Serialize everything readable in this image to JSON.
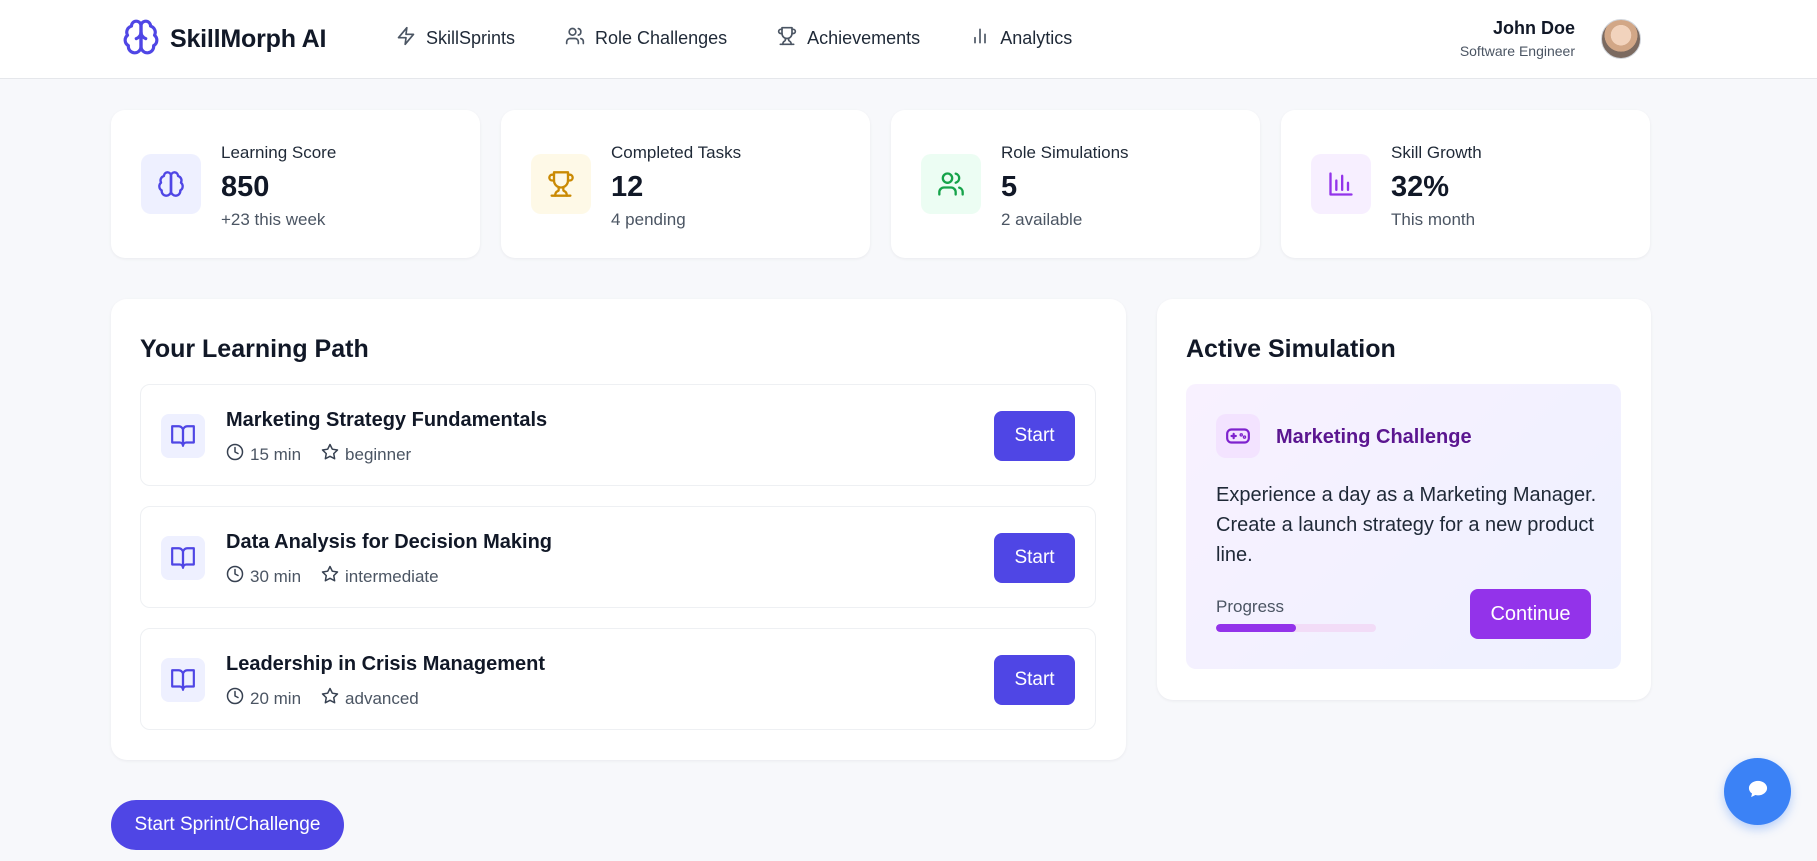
{
  "header": {
    "brand": "SkillMorph AI",
    "nav": [
      {
        "label": "SkillSprints",
        "icon": "lightning-icon"
      },
      {
        "label": "Role Challenges",
        "icon": "users-icon"
      },
      {
        "label": "Achievements",
        "icon": "trophy-icon"
      },
      {
        "label": "Analytics",
        "icon": "bar-chart-icon"
      }
    ],
    "user": {
      "name": "John Doe",
      "role": "Software Engineer"
    }
  },
  "stats": [
    {
      "label": "Learning Score",
      "value": "850",
      "sub": "+23 this week",
      "icon": "brain-icon",
      "color": "#4f46e5"
    },
    {
      "label": "Completed Tasks",
      "value": "12",
      "sub": "4 pending",
      "icon": "trophy-icon",
      "color": "#ca8a04"
    },
    {
      "label": "Role Simulations",
      "value": "5",
      "sub": "2 available",
      "icon": "users-icon",
      "color": "#16a34a"
    },
    {
      "label": "Skill Growth",
      "value": "32%",
      "sub": "This month",
      "icon": "bar-chart-icon",
      "color": "#9333ea"
    }
  ],
  "learning_path": {
    "title": "Your Learning Path",
    "items": [
      {
        "title": "Marketing Strategy Fundamentals",
        "duration": "15 min",
        "level": "beginner",
        "action": "Start"
      },
      {
        "title": "Data Analysis for Decision Making",
        "duration": "30 min",
        "level": "intermediate",
        "action": "Start"
      },
      {
        "title": "Leadership in Crisis Management",
        "duration": "20 min",
        "level": "advanced",
        "action": "Start"
      }
    ]
  },
  "simulation": {
    "title": "Active Simulation",
    "name": "Marketing Challenge",
    "description": "Experience a day as a Marketing Manager. Create a launch strategy for a new product line.",
    "progress_label": "Progress",
    "progress": 0.5,
    "action": "Continue"
  },
  "cta": "Start Sprint/Challenge",
  "colors": {
    "primary": "#4f46e5",
    "accent": "#9333ea",
    "chat": "#3b82f6"
  }
}
